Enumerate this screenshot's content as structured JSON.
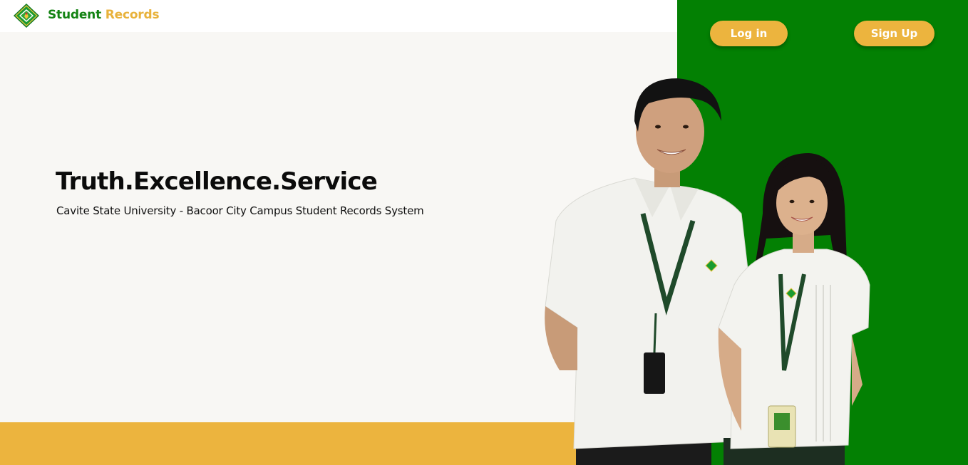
{
  "header": {
    "brand_primary": "Student",
    "brand_secondary": "Records",
    "logo_icon": "university-seal-icon"
  },
  "nav": {
    "login_label": "Log in",
    "signup_label": "Sign Up"
  },
  "hero": {
    "title": "Truth.Excellence.Service",
    "subtitle": "Cavite State University - Bacoor City Campus Student Records System"
  },
  "colors": {
    "green": "#038003",
    "yellow": "#ecb43e",
    "background": "#f8f7f4",
    "brand_green": "#138313"
  }
}
